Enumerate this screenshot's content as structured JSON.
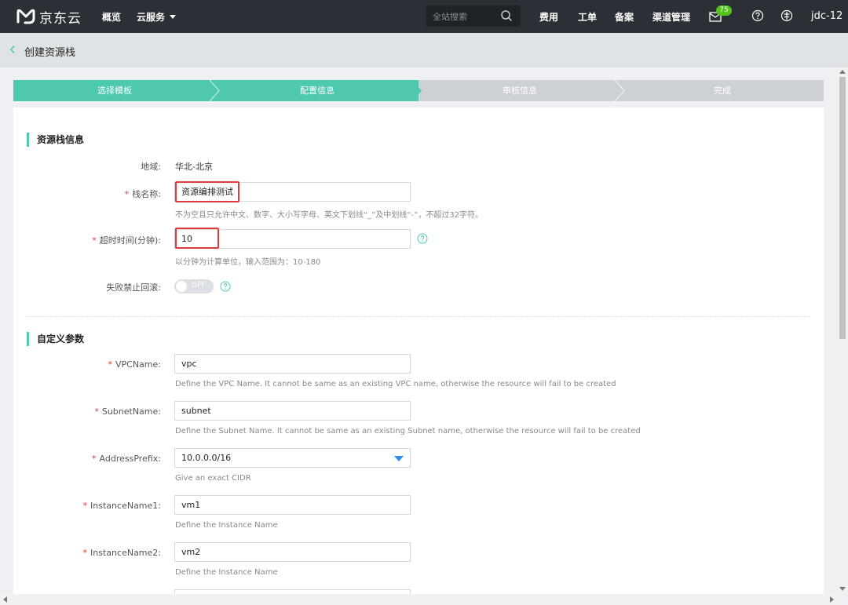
{
  "topnav": {
    "brand": "京东云",
    "overview": "概览",
    "cloud_services": "云服务",
    "search_placeholder": "全站搜索",
    "items": [
      "费用",
      "工单",
      "备案",
      "渠道管理"
    ],
    "message_count": "75",
    "user": "jdc-12"
  },
  "page": {
    "title": "创建资源栈"
  },
  "steps": [
    "选择模板",
    "配置信息",
    "审核信息",
    "完成"
  ],
  "stack_info": {
    "section_title": "资源栈信息",
    "region_label": "地域:",
    "region_value": "华北-北京",
    "name_label": "栈名称:",
    "name_value": "资源编排测试",
    "name_hint": "不为空且只允许中文、数字、大小写字母、英文下划线“_”及中划线“-”，不超过32字符。",
    "timeout_label": "超时时间(分钟):",
    "timeout_value": "10",
    "timeout_hint": "以分钟为计算单位，输入范围为：10-180",
    "rollback_label": "失败禁止回滚:",
    "rollback_state": "OFF"
  },
  "custom_params": {
    "section_title": "自定义参数",
    "vpc_label": "VPCName:",
    "vpc_value": "vpc",
    "vpc_hint": "Define the VPC Name. It cannot be same as an existing VPC name, otherwise the resource will fail to be created",
    "subnet_label": "SubnetName:",
    "subnet_value": "subnet",
    "subnet_hint": "Define the Subnet Name. It cannot be same as an existing Subnet name, otherwise the resource will fail to be created",
    "prefix_label": "AddressPrefix:",
    "prefix_value": "10.0.0.0/16",
    "prefix_hint": "Give an exact CIDR",
    "inst1_label": "InstanceName1:",
    "inst1_value": "vm1",
    "inst1_hint": "Define the Instance Name",
    "inst2_label": "InstanceName2:",
    "inst2_value": "vm2",
    "inst2_hint": "Define the Instance Name"
  },
  "colors": {
    "accent": "#4fc8b0",
    "nav_bg": "#2b3037",
    "required": "#e0393e",
    "link_blue": "#2d8cf0"
  }
}
